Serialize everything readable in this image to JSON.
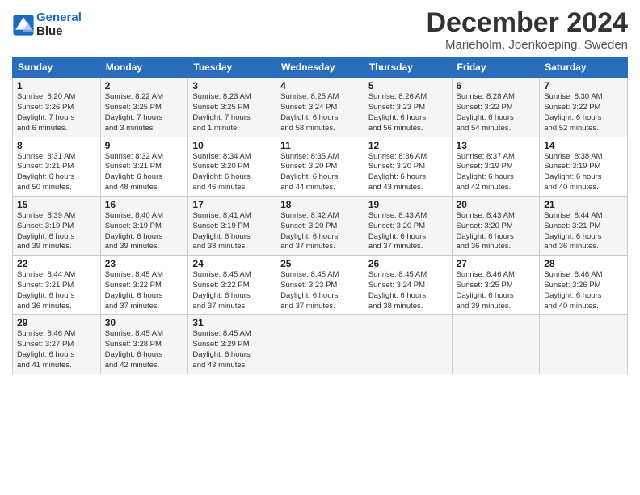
{
  "header": {
    "logo_line1": "General",
    "logo_line2": "Blue",
    "title": "December 2024",
    "subtitle": "Marieholm, Joenkoeping, Sweden"
  },
  "calendar": {
    "days_of_week": [
      "Sunday",
      "Monday",
      "Tuesday",
      "Wednesday",
      "Thursday",
      "Friday",
      "Saturday"
    ],
    "weeks": [
      [
        {
          "day": "1",
          "info": "Sunrise: 8:20 AM\nSunset: 3:26 PM\nDaylight: 7 hours\nand 6 minutes."
        },
        {
          "day": "2",
          "info": "Sunrise: 8:22 AM\nSunset: 3:25 PM\nDaylight: 7 hours\nand 3 minutes."
        },
        {
          "day": "3",
          "info": "Sunrise: 8:23 AM\nSunset: 3:25 PM\nDaylight: 7 hours\nand 1 minute."
        },
        {
          "day": "4",
          "info": "Sunrise: 8:25 AM\nSunset: 3:24 PM\nDaylight: 6 hours\nand 58 minutes."
        },
        {
          "day": "5",
          "info": "Sunrise: 8:26 AM\nSunset: 3:23 PM\nDaylight: 6 hours\nand 56 minutes."
        },
        {
          "day": "6",
          "info": "Sunrise: 8:28 AM\nSunset: 3:22 PM\nDaylight: 6 hours\nand 54 minutes."
        },
        {
          "day": "7",
          "info": "Sunrise: 8:30 AM\nSunset: 3:22 PM\nDaylight: 6 hours\nand 52 minutes."
        }
      ],
      [
        {
          "day": "8",
          "info": "Sunrise: 8:31 AM\nSunset: 3:21 PM\nDaylight: 6 hours\nand 50 minutes."
        },
        {
          "day": "9",
          "info": "Sunrise: 8:32 AM\nSunset: 3:21 PM\nDaylight: 6 hours\nand 48 minutes."
        },
        {
          "day": "10",
          "info": "Sunrise: 8:34 AM\nSunset: 3:20 PM\nDaylight: 6 hours\nand 46 minutes."
        },
        {
          "day": "11",
          "info": "Sunrise: 8:35 AM\nSunset: 3:20 PM\nDaylight: 6 hours\nand 44 minutes."
        },
        {
          "day": "12",
          "info": "Sunrise: 8:36 AM\nSunset: 3:20 PM\nDaylight: 6 hours\nand 43 minutes."
        },
        {
          "day": "13",
          "info": "Sunrise: 8:37 AM\nSunset: 3:19 PM\nDaylight: 6 hours\nand 42 minutes."
        },
        {
          "day": "14",
          "info": "Sunrise: 8:38 AM\nSunset: 3:19 PM\nDaylight: 6 hours\nand 40 minutes."
        }
      ],
      [
        {
          "day": "15",
          "info": "Sunrise: 8:39 AM\nSunset: 3:19 PM\nDaylight: 6 hours\nand 39 minutes."
        },
        {
          "day": "16",
          "info": "Sunrise: 8:40 AM\nSunset: 3:19 PM\nDaylight: 6 hours\nand 39 minutes."
        },
        {
          "day": "17",
          "info": "Sunrise: 8:41 AM\nSunset: 3:19 PM\nDaylight: 6 hours\nand 38 minutes."
        },
        {
          "day": "18",
          "info": "Sunrise: 8:42 AM\nSunset: 3:20 PM\nDaylight: 6 hours\nand 37 minutes."
        },
        {
          "day": "19",
          "info": "Sunrise: 8:43 AM\nSunset: 3:20 PM\nDaylight: 6 hours\nand 37 minutes."
        },
        {
          "day": "20",
          "info": "Sunrise: 8:43 AM\nSunset: 3:20 PM\nDaylight: 6 hours\nand 36 minutes."
        },
        {
          "day": "21",
          "info": "Sunrise: 8:44 AM\nSunset: 3:21 PM\nDaylight: 6 hours\nand 36 minutes."
        }
      ],
      [
        {
          "day": "22",
          "info": "Sunrise: 8:44 AM\nSunset: 3:21 PM\nDaylight: 6 hours\nand 36 minutes."
        },
        {
          "day": "23",
          "info": "Sunrise: 8:45 AM\nSunset: 3:22 PM\nDaylight: 6 hours\nand 37 minutes."
        },
        {
          "day": "24",
          "info": "Sunrise: 8:45 AM\nSunset: 3:22 PM\nDaylight: 6 hours\nand 37 minutes."
        },
        {
          "day": "25",
          "info": "Sunrise: 8:45 AM\nSunset: 3:23 PM\nDaylight: 6 hours\nand 37 minutes."
        },
        {
          "day": "26",
          "info": "Sunrise: 8:45 AM\nSunset: 3:24 PM\nDaylight: 6 hours\nand 38 minutes."
        },
        {
          "day": "27",
          "info": "Sunrise: 8:46 AM\nSunset: 3:25 PM\nDaylight: 6 hours\nand 39 minutes."
        },
        {
          "day": "28",
          "info": "Sunrise: 8:46 AM\nSunset: 3:26 PM\nDaylight: 6 hours\nand 40 minutes."
        }
      ],
      [
        {
          "day": "29",
          "info": "Sunrise: 8:46 AM\nSunset: 3:27 PM\nDaylight: 6 hours\nand 41 minutes."
        },
        {
          "day": "30",
          "info": "Sunrise: 8:45 AM\nSunset: 3:28 PM\nDaylight: 6 hours\nand 42 minutes."
        },
        {
          "day": "31",
          "info": "Sunrise: 8:45 AM\nSunset: 3:29 PM\nDaylight: 6 hours\nand 43 minutes."
        },
        {
          "day": "",
          "info": ""
        },
        {
          "day": "",
          "info": ""
        },
        {
          "day": "",
          "info": ""
        },
        {
          "day": "",
          "info": ""
        }
      ]
    ]
  }
}
